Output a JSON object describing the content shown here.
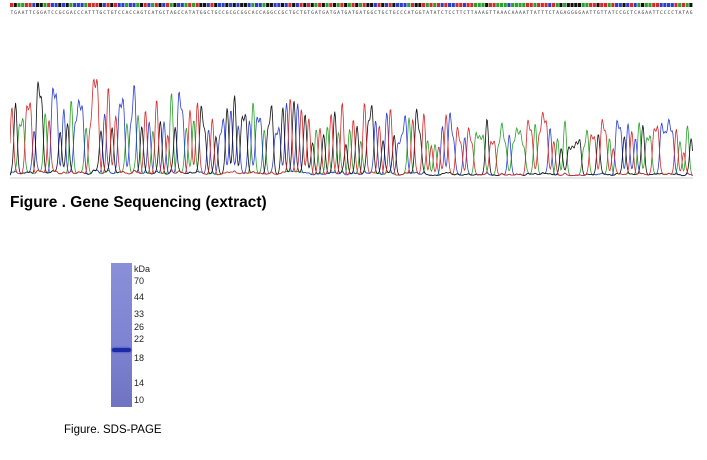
{
  "sequencing": {
    "caption": "Figure . Gene Sequencing (extract)",
    "sequence": "TGAATTCGGATCCGCGACCCATTTGCTGTCCACCAGTCATGCTAGCCATATGGCTGCCGCGCGGCACCAGGCCGCTGCTGTGATGATGATGATGATGGCTGCTGCCCATGGTATATCTCCTTCTTAAAGTTAAACAAAATTATTTCTAGAGGGGAATTGTTATCCGCTCAGAATTCCCCTATAG",
    "base_colors": {
      "A": "#2aa12a",
      "C": "#2b3fcf",
      "G": "#111111",
      "T": "#d42a2a"
    }
  },
  "gel": {
    "unit_label": "kDa",
    "markers": [
      "70",
      "44",
      "33",
      "26",
      "22",
      "18",
      "14",
      "10"
    ],
    "lane_color": "#7e84d2",
    "band_color": "#1b2aa6",
    "caption": "Figure. SDS-PAGE"
  }
}
